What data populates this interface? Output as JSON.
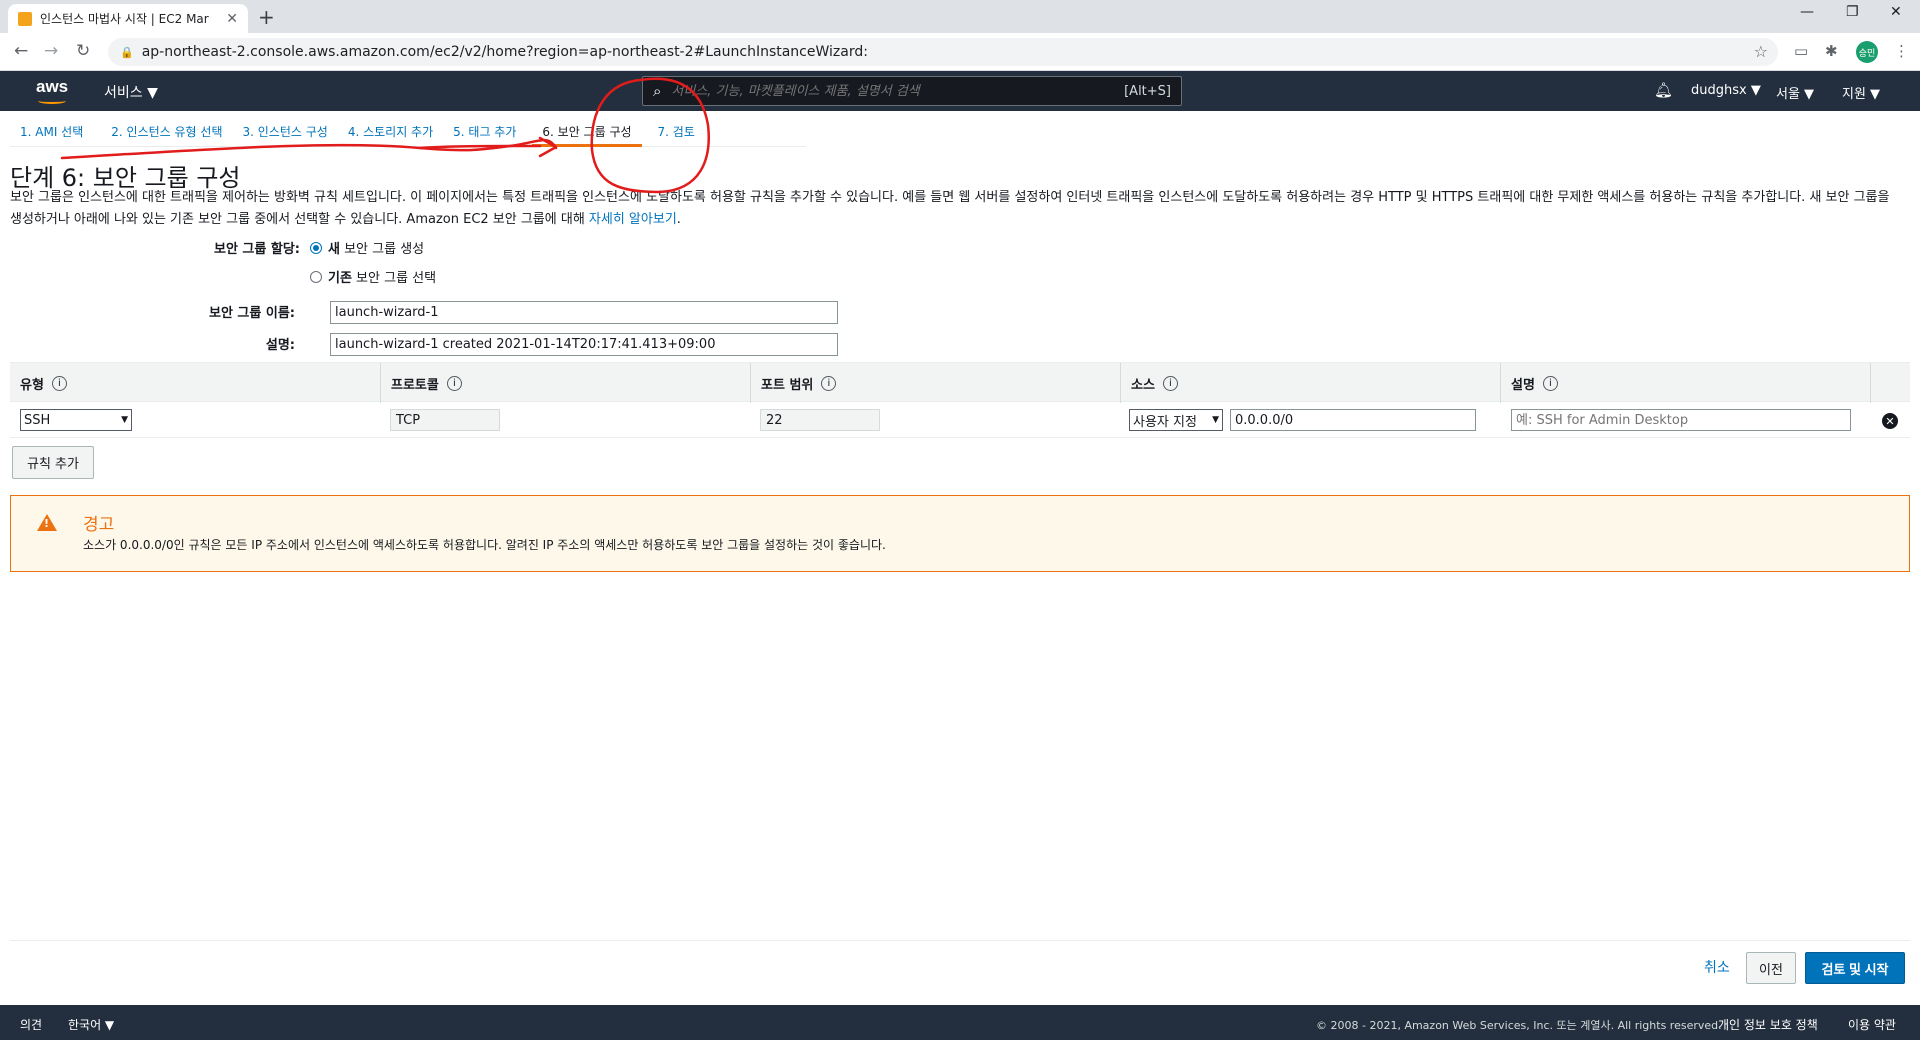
{
  "browser": {
    "tab_title": "인스턴스 마법사 시작 | EC2 Mar",
    "url": "ap-northeast-2.console.aws.amazon.com/ec2/v2/home?region=ap-northeast-2#LaunchInstanceWizard:",
    "profile_initials": "승민"
  },
  "aws_header": {
    "logo": "aws",
    "services_label": "서비스 ▼",
    "search_placeholder": "서비스, 기능, 마켓플레이스 제품, 설명서 검색",
    "search_shortcut": "[Alt+S]",
    "user": "dudghsx ▼",
    "region": "서울 ▼",
    "support": "지원 ▼"
  },
  "wizard_steps": [
    {
      "label": "1. AMI 선택"
    },
    {
      "label": "2. 인스턴스 유형 선택"
    },
    {
      "label": "3. 인스턴스 구성"
    },
    {
      "label": "4. 스토리지 추가"
    },
    {
      "label": "5. 태그 추가"
    },
    {
      "label": "6. 보안 그룹 구성"
    },
    {
      "label": "7. 검토"
    }
  ],
  "page": {
    "title": "단계 6: 보안 그룹 구성",
    "description": "보안 그룹은 인스턴스에 대한 트래픽을 제어하는 방화벽 규칙 세트입니다. 이 페이지에서는 특정 트래픽을 인스턴스에 도달하도록 허용할 규칙을 추가할 수 있습니다. 예를 들면 웹 서버를 설정하여 인터넷 트래픽을 인스턴스에 도달하도록 허용하려는 경우 HTTP 및 HTTPS 트래픽에 대한 무제한 액세스를 허용하는 규칙을 추가합니다. 새 보안 그룹을 생성하거나 아래에 나와 있는 기존 보안 그룹 중에서 선택할 수 있습니다. Amazon EC2 보안 그룹에 대해 ",
    "learn_more": "자세히 알아보기",
    "period": "."
  },
  "form": {
    "assign_label": "보안 그룹 할당:",
    "option_new_bold": "새",
    "option_new_rest": " 보안 그룹 생성",
    "option_existing_bold": "기존",
    "option_existing_rest": " 보안 그룹 선택",
    "name_label": "보안 그룹 이름:",
    "name_value": "launch-wizard-1",
    "desc_label": "설명:",
    "desc_value": "launch-wizard-1 created 2021-01-14T20:17:41.413+09:00"
  },
  "rules_table": {
    "headers": [
      "유형",
      "프로토콜",
      "포트 범위",
      "소스",
      "설명"
    ],
    "info_glyph": "i",
    "rows": [
      {
        "type": "SSH",
        "protocol": "TCP",
        "port": "22",
        "source_mode": "사용자 지정",
        "source_cidr": "0.0.0.0/0",
        "description_placeholder": "예: SSH for Admin Desktop"
      }
    ],
    "add_rule": "규칙 추가"
  },
  "warning": {
    "title": "경고",
    "text": "소스가 0.0.0.0/0인 규칙은 모든 IP 주소에서 인스턴스에 액세스하도록 허용합니다. 알려진 IP 주소의 액세스만 허용하도록 보안 그룹을 설정하는 것이 좋습니다."
  },
  "actions": {
    "cancel": "취소",
    "previous": "이전",
    "review_launch": "검토 및 시작"
  },
  "footer": {
    "feedback": "의견",
    "language": "한국어 ▼",
    "copyright": "© 2008 - 2021, Amazon Web Services, Inc. 또는 계열사. All rights reserved.",
    "privacy": "개인 정보 보호 정책",
    "terms": "이용 약관"
  },
  "colors": {
    "aws_dark": "#232f3e",
    "link_blue": "#0073bb",
    "aws_orange": "#ec7211",
    "annotation_red": "#e21b1b"
  }
}
